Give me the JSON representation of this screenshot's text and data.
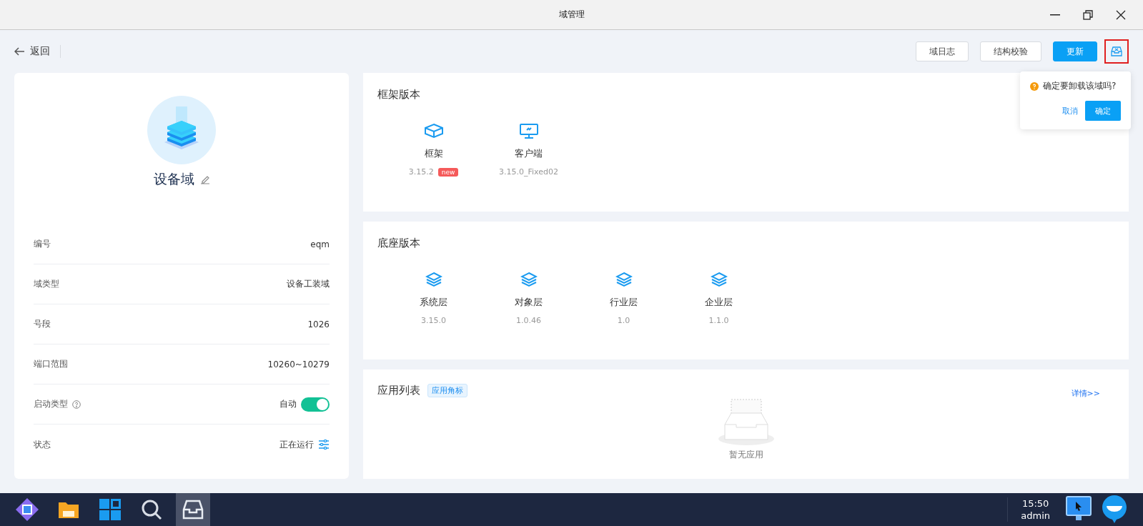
{
  "window": {
    "title": "域管理"
  },
  "toolbar": {
    "back": "返回",
    "buttons": [
      {
        "label": "域日志",
        "kind": "plain"
      },
      {
        "label": "结构校验",
        "kind": "plain"
      },
      {
        "label": "更新",
        "kind": "primary"
      }
    ],
    "uninstall_highlighted": true
  },
  "popover": {
    "message": "确定要卸载该域吗?",
    "cancel": "取消",
    "confirm": "确定"
  },
  "domain": {
    "name": "设备域"
  },
  "properties": [
    {
      "label": "编号",
      "value": "eqm",
      "kind": "text"
    },
    {
      "label": "域类型",
      "value": "设备工装域",
      "kind": "text"
    },
    {
      "label": "号段",
      "value": "1026",
      "kind": "text"
    },
    {
      "label": "端口范围",
      "value": "10260~10279",
      "kind": "text"
    },
    {
      "label": "启动类型",
      "value": "自动",
      "kind": "toggle",
      "on": true
    },
    {
      "label": "状态",
      "value": "正在运行",
      "kind": "status"
    }
  ],
  "framework": {
    "title": "框架版本",
    "items": [
      {
        "name": "框架",
        "version": "3.15.2",
        "kind": "cube",
        "badge": "new"
      },
      {
        "name": "客户端",
        "version": "3.15.0_Fixed02",
        "kind": "monitor"
      }
    ]
  },
  "base": {
    "title": "底座版本",
    "items": [
      {
        "name": "系统层",
        "version": "3.15.0"
      },
      {
        "name": "对象层",
        "version": "1.0.46"
      },
      {
        "name": "行业层",
        "version": "1.0"
      },
      {
        "name": "企业层",
        "version": "1.1.0"
      }
    ]
  },
  "apps": {
    "title": "应用列表",
    "tag": "应用角标",
    "link": "详情>>",
    "empty": "暂无应用"
  },
  "taskbar": {
    "apps": [
      {
        "kind": "logo",
        "selected": false
      },
      {
        "kind": "folder",
        "selected": false
      },
      {
        "kind": "windows",
        "selected": false
      },
      {
        "kind": "search",
        "selected": false
      },
      {
        "kind": "inbox",
        "selected": true
      }
    ],
    "time": "15:50",
    "user": "admin"
  }
}
